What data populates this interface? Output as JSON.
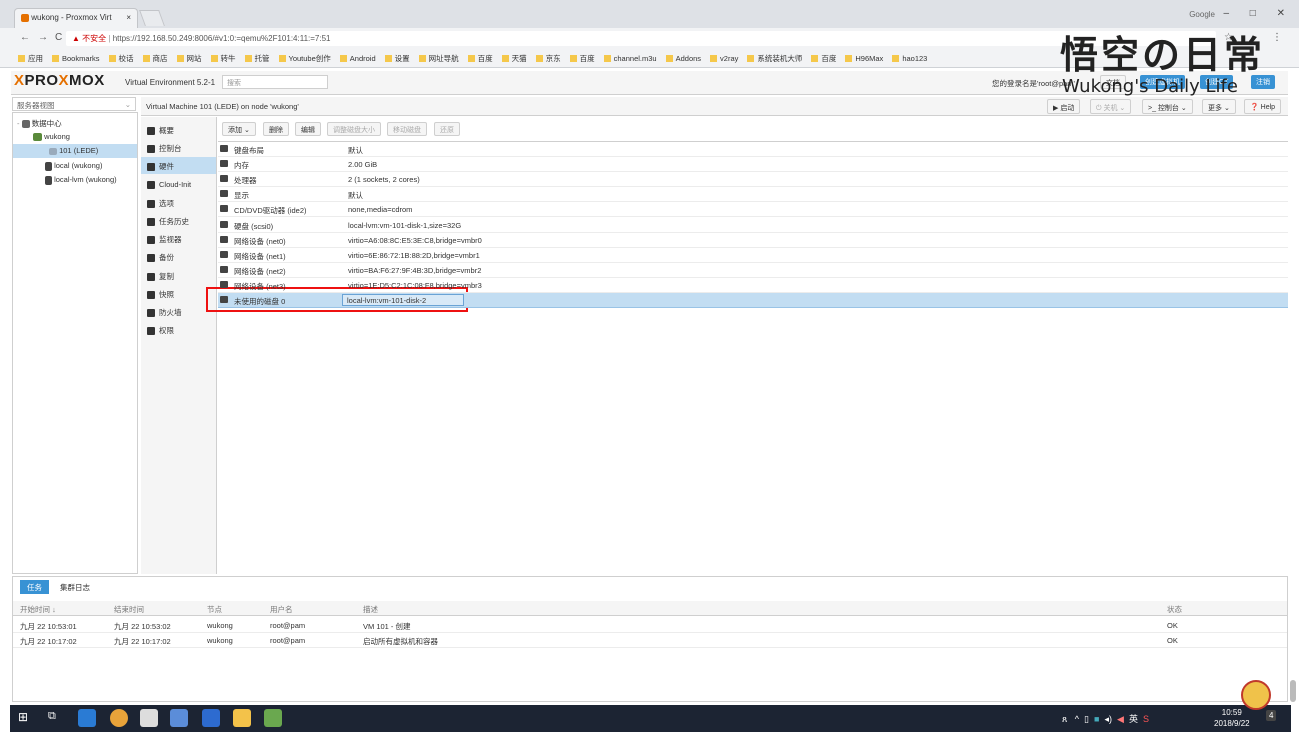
{
  "browser": {
    "tab_title": "wukong - Proxmox Virt",
    "tab_close": "×",
    "profile_name": "Google",
    "win_min": "–",
    "win_max": "□",
    "win_close": "✕",
    "security_label": "不安全",
    "url": "https://192.168.50.249:8006/#v1:0:=qemu%2F101:4:11:=7:51",
    "bookmarks": [
      "应用",
      "Bookmarks",
      "校话",
      "商店",
      "网站",
      "转牛",
      "托管",
      "Youtube创作",
      "Android",
      "设置",
      "网址导航",
      "百度",
      "天猫",
      "京东",
      "百度",
      "channel.m3u",
      "Addons",
      "v2ray",
      "系统装机大师",
      "百度",
      "H96Max",
      "hao123"
    ]
  },
  "watermark": {
    "logo": "悟空の日常",
    "subtitle": "Wukong's Daily Life"
  },
  "pve": {
    "logo_left": "PRO",
    "logo_x": "X",
    "logo_right": "MOX",
    "version": "Virtual Environment 5.2-1",
    "search_placeholder": "搜索",
    "logged_in": "您的登录名是'root@pam'",
    "btn_docs": "文档",
    "btn_create_vm": "创建虚拟机",
    "btn_create_ct": "创建CT",
    "btn_logout": "注销"
  },
  "tree": {
    "view_select": "服务器视图",
    "datacenter": "数据中心",
    "node": "wukong",
    "vm": "101 (LEDE)",
    "storage_local": "local (wukong)",
    "storage_lvm": "local-lvm (wukong)"
  },
  "vm_header": {
    "title": "Virtual Machine 101 (LEDE) on node 'wukong'",
    "btn_start": "启动",
    "btn_shutdown": "关机",
    "btn_console": "控制台",
    "btn_more": "更多",
    "btn_help": "Help"
  },
  "vm_nav": [
    "概要",
    "控制台",
    "硬件",
    "Cloud-Init",
    "选项",
    "任务历史",
    "监视器",
    "备份",
    "复制",
    "快照",
    "防火墙",
    "权限"
  ],
  "toolbar": {
    "add": "添加",
    "remove": "删除",
    "edit": "编辑",
    "resize": "调整磁盘大小",
    "move": "移动磁盘",
    "revert": "还原"
  },
  "hardware": [
    {
      "key": "键盘布局",
      "value": "默认"
    },
    {
      "key": "内存",
      "value": "2.00 GiB"
    },
    {
      "key": "处理器",
      "value": "2 (1 sockets, 2 cores)"
    },
    {
      "key": "显示",
      "value": "默认"
    },
    {
      "key": "CD/DVD驱动器 (ide2)",
      "value": "none,media=cdrom"
    },
    {
      "key": "硬盘 (scsi0)",
      "value": "local-lvm:vm-101-disk-1,size=32G"
    },
    {
      "key": "网络设备 (net0)",
      "value": "virtio=A6:08:8C:E5:3E:C8,bridge=vmbr0"
    },
    {
      "key": "网络设备 (net1)",
      "value": "virtio=6E:86:72:1B:88:2D,bridge=vmbr1"
    },
    {
      "key": "网络设备 (net2)",
      "value": "virtio=BA:F6:27:9F:4B:3D,bridge=vmbr2"
    },
    {
      "key": "网络设备 (net3)",
      "value": "virtio=1E:D5:C2:1C:08:F8,bridge=vmbr3"
    },
    {
      "key": "未使用的磁盘 0",
      "value": "local-lvm:vm-101-disk-2"
    }
  ],
  "log": {
    "tab_tasks": "任务",
    "tab_cluster": "集群日志",
    "headers": [
      "开始时间 ↓",
      "结束时间",
      "节点",
      "用户名",
      "描述",
      "状态"
    ],
    "rows": [
      [
        "九月 22 10:53:01",
        "九月 22 10:53:02",
        "wukong",
        "root@pam",
        "VM 101 - 创建",
        "OK"
      ],
      [
        "九月 22 10:17:02",
        "九月 22 10:17:02",
        "wukong",
        "root@pam",
        "启动所有虚拟机和容器",
        "OK"
      ]
    ]
  },
  "taskbar": {
    "time": "10:59",
    "date": "2018/9/22",
    "lang": "英",
    "notif_count": "4"
  },
  "colors": {
    "accent": "#3892d4",
    "selection": "#c2ddf2",
    "highlight_box": "#e11111",
    "logo_x": "#e57000"
  }
}
